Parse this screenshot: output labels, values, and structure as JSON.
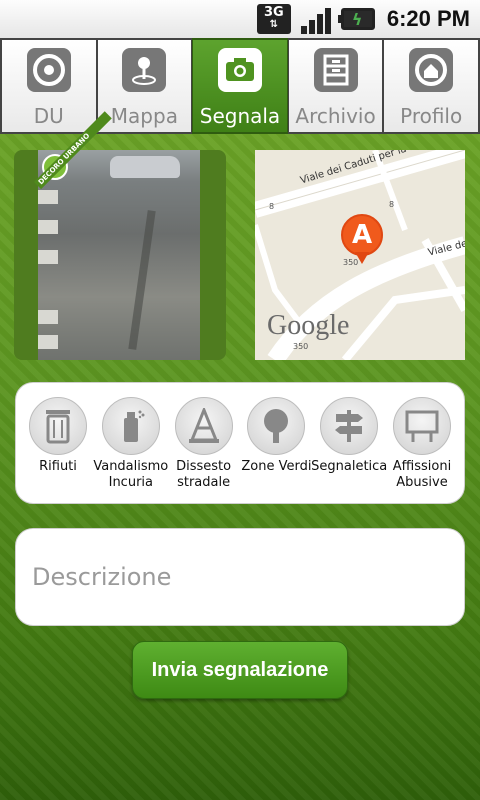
{
  "status_bar": {
    "network": "3G",
    "time": "6:20 PM"
  },
  "tabs": [
    {
      "label": "DU",
      "icon": "du-logo-icon",
      "active": false
    },
    {
      "label": "Mappa",
      "icon": "map-pin-icon",
      "active": false
    },
    {
      "label": "Segnala",
      "icon": "camera-icon",
      "active": true
    },
    {
      "label": "Archivio",
      "icon": "archive-cabinet-icon",
      "active": false
    },
    {
      "label": "Profilo",
      "icon": "profile-home-icon",
      "active": false
    }
  ],
  "photo": {
    "badge_text": "DECORO URBANO"
  },
  "map": {
    "streets": [
      "Viale dei Caduti per la Resistenza",
      "Viale de"
    ],
    "numbers": [
      "8",
      "8",
      "350",
      "350"
    ],
    "pin_letter": "A",
    "brand": "Google"
  },
  "categories": [
    {
      "label": "Rifiuti",
      "icon": "trash-bin-icon"
    },
    {
      "label": "Vandalismo\nIncuria",
      "icon": "spray-can-icon"
    },
    {
      "label": "Dissesto\nstradale",
      "icon": "traffic-cone-icon"
    },
    {
      "label": "Zone Verdi",
      "icon": "tree-icon"
    },
    {
      "label": "Segnaletica",
      "icon": "signpost-icon"
    },
    {
      "label": "Affissioni\nAbusive",
      "icon": "billboard-icon"
    }
  ],
  "description": {
    "placeholder": "Descrizione"
  },
  "submit": {
    "label": "Invia segnalazione"
  },
  "colors": {
    "accent_green": "#4f9320",
    "pin_orange": "#f05a1c"
  }
}
